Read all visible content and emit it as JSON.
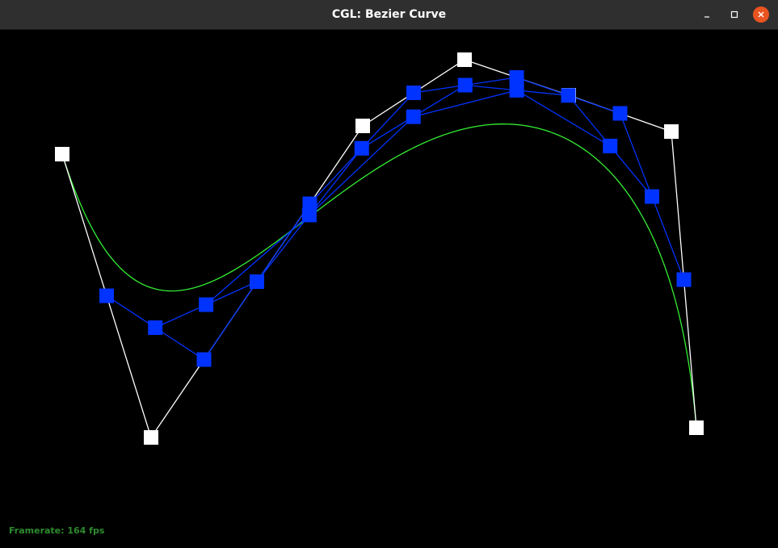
{
  "window": {
    "title": "CGL: Bezier Curve"
  },
  "status": {
    "framerate_text": "Framerate: 164 fps"
  },
  "colors": {
    "titlebar": "#2f2f2f",
    "close_button": "#e95420",
    "canvas_background": "#000000",
    "control_polygon": "#ffffff",
    "intermediate_polygon": "#0033ff",
    "curve": "#33ee33",
    "framerate_text": "#2e8b2e"
  },
  "icons": {
    "minimize": "minimize-icon",
    "maximize": "maximize-icon",
    "close": "close-icon"
  }
}
